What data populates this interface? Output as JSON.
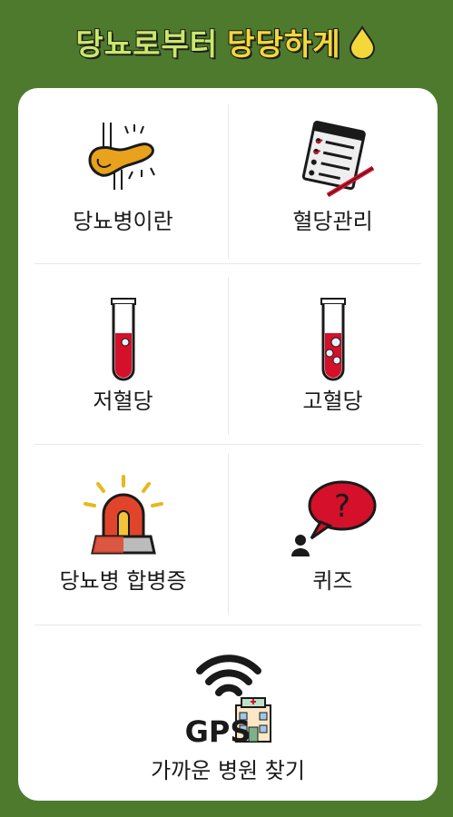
{
  "header": {
    "title_part1": "당뇨로부터",
    "title_part2": "당당하게",
    "drop_icon": "drop-icon"
  },
  "menu": {
    "diabetes": {
      "label": "당뇨병이란",
      "icon": "pancreas-icon"
    },
    "blood_sugar_mgmt": {
      "label": "혈당관리",
      "icon": "checklist-icon"
    },
    "hypoglycemia": {
      "label": "저혈당",
      "icon": "test-tube-icon"
    },
    "hyperglycemia": {
      "label": "고혈당",
      "icon": "test-tube-icon"
    },
    "complications": {
      "label": "당뇨병 합병증",
      "icon": "siren-icon"
    },
    "quiz": {
      "label": "퀴즈",
      "icon": "question-bubble-icon"
    },
    "gps": {
      "label": "가까운 병원 찾기",
      "icon": "gps-hospital-icon",
      "gps_text": "GPS"
    }
  },
  "colors": {
    "background": "#4e7a2e",
    "title_green": "#c9e86a",
    "title_yellow": "#f3d83a",
    "blood_red": "#d4102a",
    "siren_red": "#e0452b"
  }
}
